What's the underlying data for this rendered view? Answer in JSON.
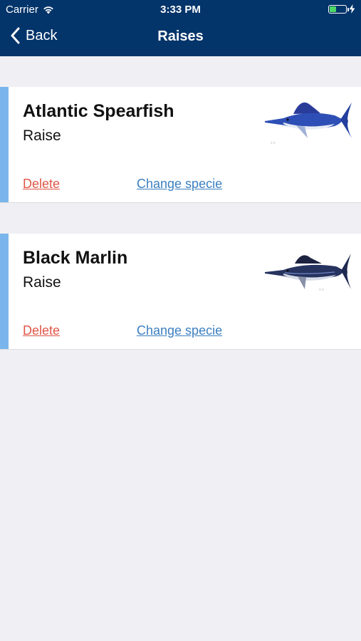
{
  "status_bar": {
    "carrier": "Carrier",
    "time": "3:33 PM"
  },
  "nav": {
    "back_label": "Back",
    "title": "Raises"
  },
  "raises": [
    {
      "species": "Atlantic Spearfish",
      "type": "Raise",
      "delete_label": "Delete",
      "change_label": "Change specie",
      "image_icon": "spearfish-illustration"
    },
    {
      "species": "Black Marlin",
      "type": "Raise",
      "delete_label": "Delete",
      "change_label": "Change specie",
      "image_icon": "marlin-illustration"
    }
  ],
  "colors": {
    "header": "#03346a",
    "accent_bar": "#7ab6ec",
    "delete": "#e05545",
    "link": "#3b7fc0",
    "background": "#efeff4"
  }
}
